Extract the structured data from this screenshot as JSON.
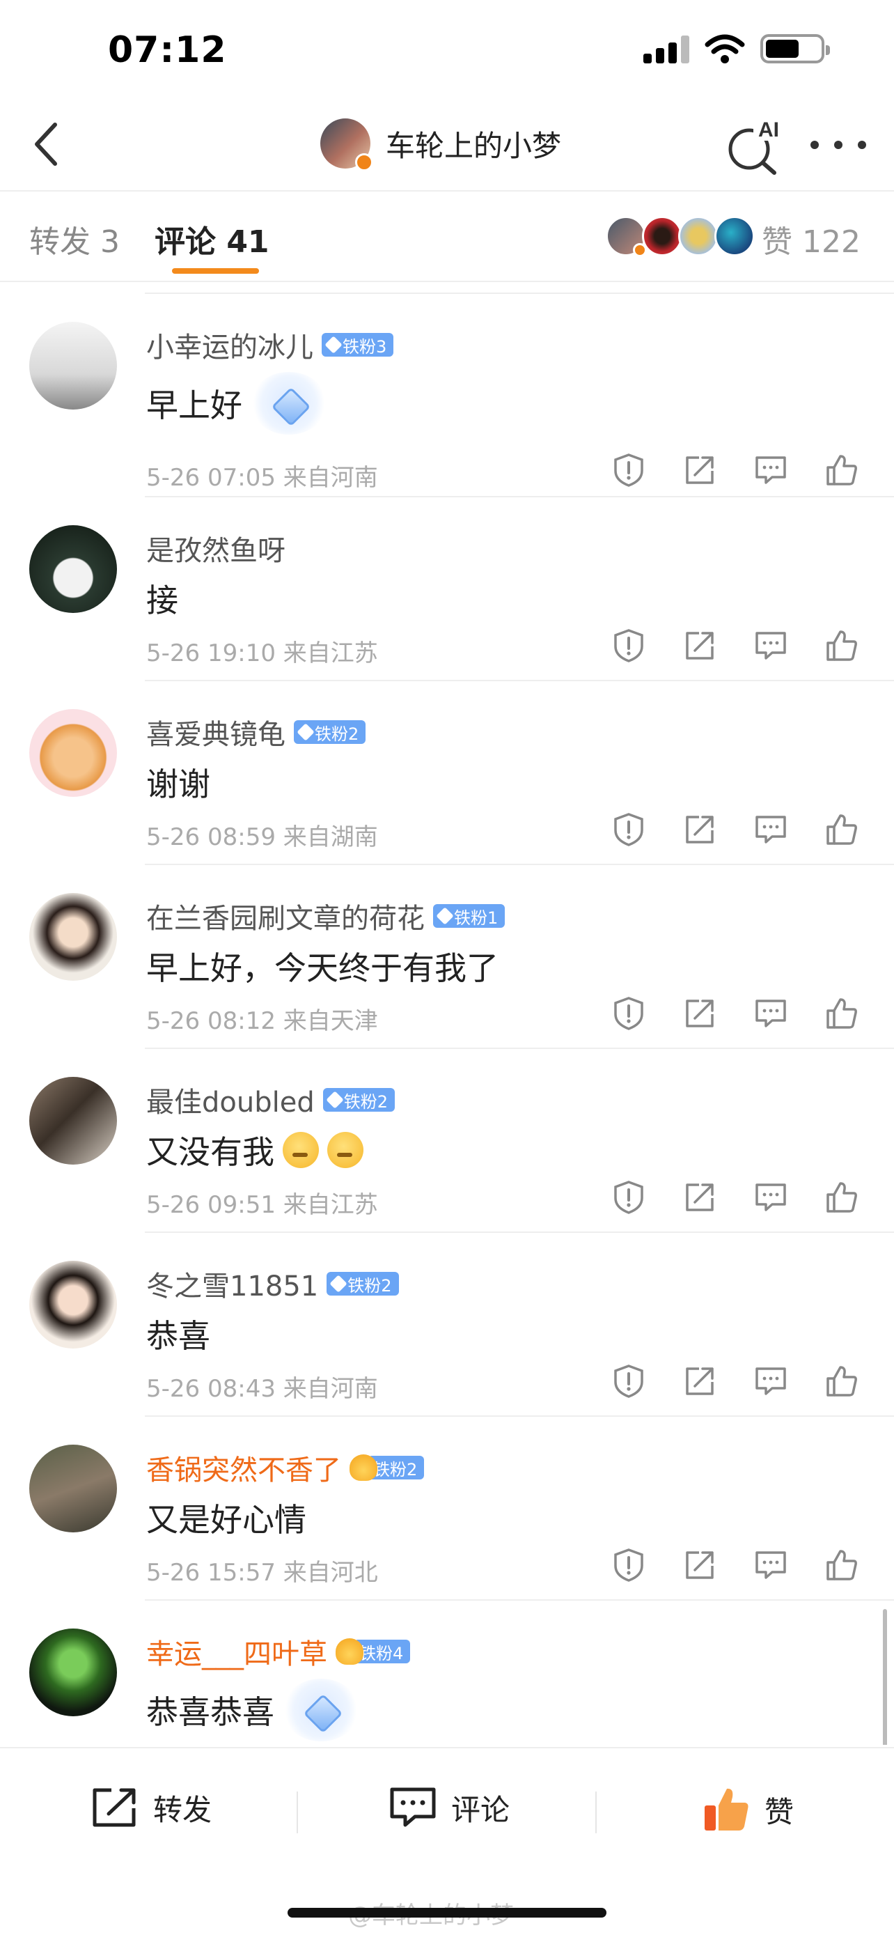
{
  "status_bar": {
    "time": "07:12"
  },
  "header": {
    "title": "车轮上的小梦"
  },
  "tabs": {
    "repost": "转发 3",
    "comments": "评论 41",
    "likes": "赞 122"
  },
  "comments": [
    {
      "name": "小幸运的冰儿",
      "badge": "铁粉3",
      "text": "早上好",
      "time": "5-26 07:05",
      "location": "来自河南"
    },
    {
      "name": "是孜然鱼呀",
      "badge": "",
      "text": "接",
      "time": "5-26 19:10",
      "location": "来自江苏"
    },
    {
      "name": "喜爱典镜龟",
      "badge": "铁粉2",
      "text": "谢谢",
      "time": "5-26 08:59",
      "location": "来自湖南"
    },
    {
      "name": "在兰香园刷文章的荷花",
      "badge": "铁粉1",
      "text": "早上好，今天终于有我了",
      "time": "5-26 08:12",
      "location": "来自天津"
    },
    {
      "name": "最佳doubled",
      "badge": "铁粉2",
      "text": "又没有我",
      "time": "5-26 09:51",
      "location": "来自江苏"
    },
    {
      "name": "冬之雪11851",
      "badge": "铁粉2",
      "text": "恭喜",
      "time": "5-26 08:43",
      "location": "来自河南"
    },
    {
      "name": "香锅突然不香了",
      "badge": "铁粉2",
      "text": "又是好心情",
      "time": "5-26 15:57",
      "location": "来自河北"
    },
    {
      "name": "幸运___四叶草",
      "badge": "铁粉4",
      "text": "恭喜恭喜",
      "time": "",
      "location": ""
    }
  ],
  "bottom_bar": {
    "repost": "转发",
    "comment": "评论",
    "like": "赞"
  },
  "watermark": "@车轮上的小梦",
  "colors": {
    "accent": "#f38a1c",
    "badge_blue": "#6aa5f5",
    "vip_name": "#ef6a18"
  }
}
